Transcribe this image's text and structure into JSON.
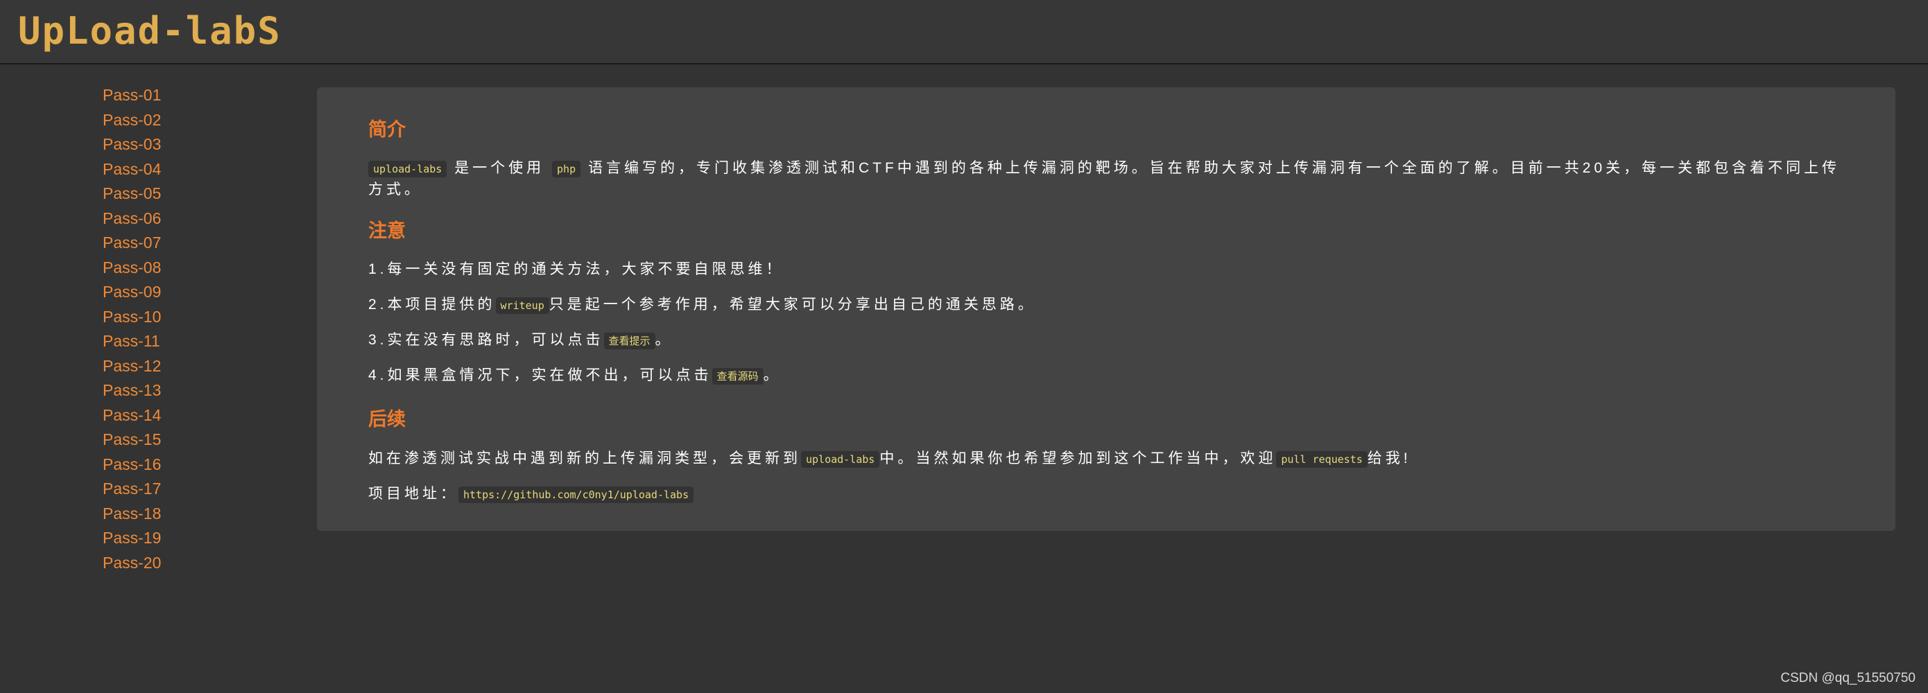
{
  "header": {
    "logo_text": "UpLoad-labS"
  },
  "sidebar": {
    "items": [
      "Pass-01",
      "Pass-02",
      "Pass-03",
      "Pass-04",
      "Pass-05",
      "Pass-06",
      "Pass-07",
      "Pass-08",
      "Pass-09",
      "Pass-10",
      "Pass-11",
      "Pass-12",
      "Pass-13",
      "Pass-14",
      "Pass-15",
      "Pass-16",
      "Pass-17",
      "Pass-18",
      "Pass-19",
      "Pass-20"
    ]
  },
  "content": {
    "intro": {
      "title": "简介",
      "code1": "upload-labs",
      "text1": "是一个使用",
      "code2": "php",
      "text2": "语言编写的，专门收集渗透测试和CTF中遇到的各种上传漏洞的靶场。旨在帮助大家对上传漏洞有一个全面的了解。目前一共20关，每一关都包含着不同上传方式。"
    },
    "notice": {
      "title": "注意",
      "line1": "1.每一关没有固定的通关方法，大家不要自限思维！",
      "line2_a": "2.本项目提供的",
      "line2_code": "writeup",
      "line2_b": "只是起一个参考作用，希望大家可以分享出自己的通关思路。",
      "line3_a": "3.实在没有思路时，可以点击",
      "line3_code": "查看提示",
      "line3_b": "。",
      "line4_a": "4.如果黑盒情况下，实在做不出，可以点击",
      "line4_code": "查看源码",
      "line4_b": "。"
    },
    "followup": {
      "title": "后续",
      "text_a": "如在渗透测试实战中遇到新的上传漏洞类型，会更新到",
      "code_a": "upload-labs",
      "text_b": "中。当然如果你也希望参加到这个工作当中，欢迎",
      "code_b": "pull requests",
      "text_c": "给我!",
      "addr_label": "项目地址：",
      "addr_url": "https://github.com/c0ny1/upload-labs"
    }
  },
  "watermark": "CSDN @qq_51550750",
  "colors": {
    "background": "#333333",
    "panel": "#444444",
    "accent": "#f07a2a",
    "link": "#f08a38",
    "logo": "#e0ad4f",
    "code": "#e6d97a"
  }
}
